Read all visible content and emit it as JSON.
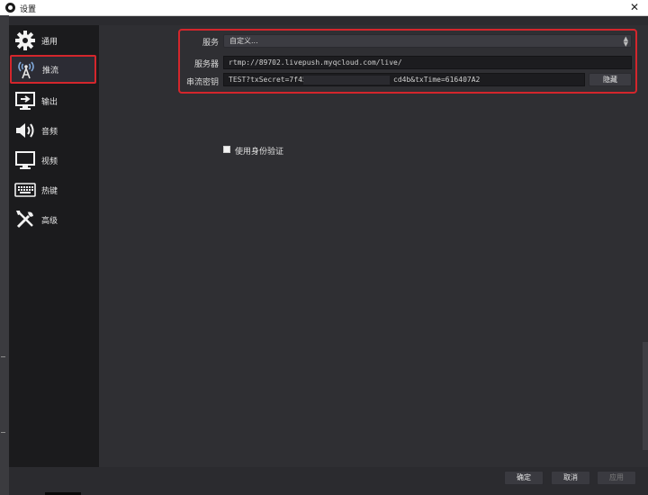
{
  "window": {
    "title": "设置",
    "icons": {
      "app": "obs-logo-icon",
      "close": "close-icon"
    }
  },
  "sidebar": {
    "items": [
      {
        "label": "通用",
        "icon": "gear-icon"
      },
      {
        "label": "推流",
        "icon": "broadcast-antenna-icon",
        "selected": true
      },
      {
        "label": "输出",
        "icon": "output-monitor-icon"
      },
      {
        "label": "音频",
        "icon": "speaker-icon"
      },
      {
        "label": "视频",
        "icon": "monitor-icon"
      },
      {
        "label": "热键",
        "icon": "keyboard-icon"
      },
      {
        "label": "高级",
        "icon": "tools-icon"
      }
    ]
  },
  "stream": {
    "service_label": "服务",
    "service_value": "自定义...",
    "server_label": "服务器",
    "server_value": "rtmp://89702.livepush.myqcloud.com/live/",
    "key_label": "串流密钥",
    "key_value_start": "TEST?txSecret=7f45",
    "key_value_end": "cd4b&txTime=616407A2",
    "hide_button": "隐藏"
  },
  "auth": {
    "checkbox_label": "使用身份验证",
    "checked": false
  },
  "footer": {
    "ok": "确定",
    "cancel": "取消",
    "apply": "应用"
  },
  "colors": {
    "highlight": "#d4262c",
    "sidebar_bg": "#1b1b1d",
    "content_bg": "#2f2f33"
  }
}
